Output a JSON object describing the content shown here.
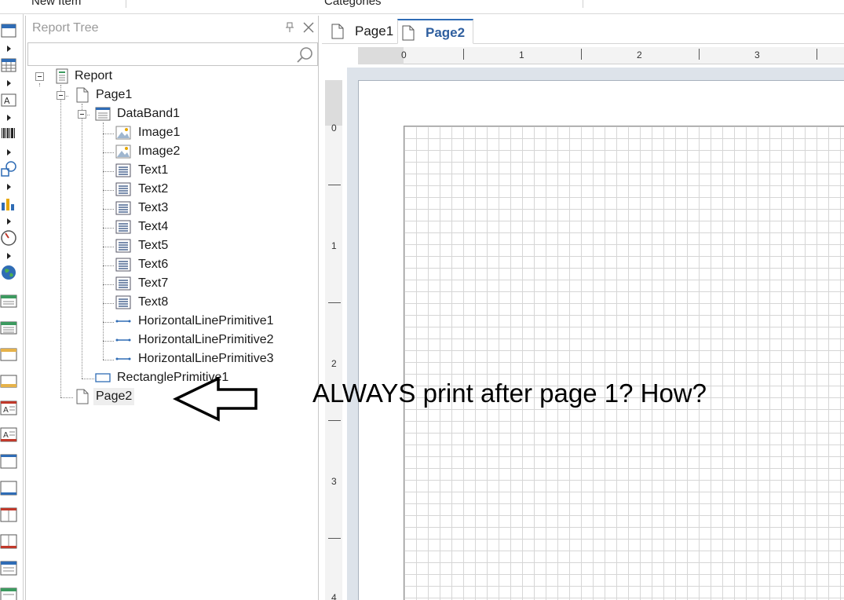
{
  "header": {
    "new_item_label": "New Item",
    "categories_label": "Categories"
  },
  "report_tree": {
    "title": "Report Tree",
    "search": {
      "value": "",
      "placeholder": ""
    },
    "nodes": {
      "report": "Report",
      "page1": "Page1",
      "databand1": "DataBand1",
      "image1": "Image1",
      "image2": "Image2",
      "text1": "Text1",
      "text2": "Text2",
      "text3": "Text3",
      "text4": "Text4",
      "text5": "Text5",
      "text6": "Text6",
      "text7": "Text7",
      "text8": "Text8",
      "hline1": "HorizontalLinePrimitive1",
      "hline2": "HorizontalLinePrimitive2",
      "hline3": "HorizontalLinePrimitive3",
      "rect1": "RectanglePrimitive1",
      "page2": "Page2"
    }
  },
  "designer": {
    "tabs": [
      {
        "label": "Page1",
        "active": false
      },
      {
        "label": "Page2",
        "active": true
      }
    ],
    "hruler_labels": [
      "0",
      "1",
      "2",
      "3"
    ],
    "vruler_labels": [
      "0",
      "1",
      "2",
      "3",
      "4"
    ]
  },
  "annotation": {
    "text": "ALWAYS print after page 1? How?"
  },
  "colors": {
    "accent": "#2f6cb5",
    "canvas_bg": "#dde3ea",
    "grid_line": "#d6d6d6"
  }
}
